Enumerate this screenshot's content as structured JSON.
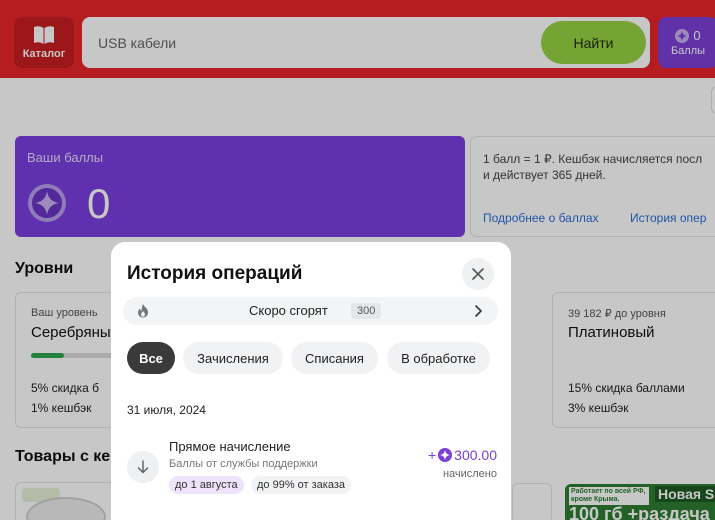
{
  "header": {
    "catalog_label": "Каталог",
    "search_placeholder": "USB кабели",
    "search_button": "Найти",
    "points_count": "0",
    "points_label": "Баллы",
    "colors": {
      "header_bg": "#e8262a",
      "search_button_bg": "#97d344",
      "points_bg": "#7b3fd6"
    }
  },
  "balance": {
    "title": "Ваши баллы",
    "amount": "0"
  },
  "info": {
    "text_line1": "1 балл = 1 ₽. Кешбэк начисляется посл",
    "text_line2": "и действует 365 дней.",
    "link_more": "Подробнее о баллах",
    "link_history": "История опер"
  },
  "levels": {
    "heading": "Уровни",
    "current": {
      "caption": "Ваш уровень",
      "name": "Серебряны",
      "progress": 0.35,
      "line1": "5% скидка б",
      "line2": "1% кешбэк"
    },
    "next": {
      "caption": "39 182 ₽ до уровня",
      "name": "Платиновый",
      "line1": "15% скидка баллами",
      "line2": "3% кешбэк"
    }
  },
  "goods": {
    "heading": "Товары с ке",
    "promo_small": "Работает по всей РФ, кроме Крыма.",
    "promo_big1": "Новая SI",
    "promo_big2": "100 гб +раздача"
  },
  "modal": {
    "title": "История операций",
    "expiring_label": "Скоро сгорят",
    "expiring_count": "300",
    "tabs": [
      {
        "label": "Все",
        "active": true
      },
      {
        "label": "Зачисления",
        "active": false
      },
      {
        "label": "Списания",
        "active": false
      },
      {
        "label": "В обработке",
        "active": false
      }
    ],
    "date": "31 июля, 2024",
    "operation": {
      "title": "Прямое начисление",
      "subtitle": "Баллы от службы поддержки",
      "chip_expiry": "до 1 августа",
      "chip_limit": "до 99% от заказа",
      "amount_prefix": "+",
      "amount": "300.00",
      "status": "начислено"
    }
  }
}
